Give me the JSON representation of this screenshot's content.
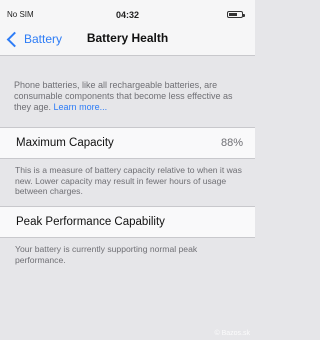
{
  "status_bar": {
    "carrier": "No SIM",
    "time": "04:32"
  },
  "nav": {
    "back_label": "Battery",
    "title": "Battery Health"
  },
  "intro": {
    "text": "Phone batteries, like all rechargeable batteries, are consumable components that become less effective as they age.",
    "link": "Learn more..."
  },
  "maximum_capacity": {
    "label": "Maximum Capacity",
    "value": "88%",
    "description": "This is a measure of battery capacity relative to when it was new. Lower capacity may result in fewer hours of usage between charges."
  },
  "peak_performance": {
    "label": "Peak Performance Capability",
    "description": "Your battery is currently supporting normal peak performance."
  },
  "watermark": "© Bazos.sk",
  "colors": {
    "accent": "#2d7cf6",
    "background": "#e6e6e9",
    "cell_background": "#f9f9fa",
    "secondary_text": "#6f6f74"
  }
}
